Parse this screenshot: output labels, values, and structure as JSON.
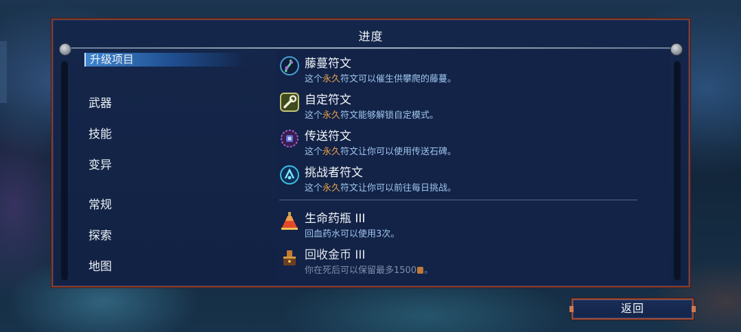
{
  "panel": {
    "title": "进度"
  },
  "categories": [
    {
      "label": "升级项目",
      "selected": true
    },
    {
      "label": "武器",
      "selected": false
    },
    {
      "label": "技能",
      "selected": false
    },
    {
      "label": "变异",
      "selected": false
    },
    {
      "label": "常规",
      "selected": false
    },
    {
      "label": "探索",
      "selected": false
    },
    {
      "label": "地图",
      "selected": false
    }
  ],
  "items": [
    {
      "name": "藤蔓符文",
      "desc_pre": "这个",
      "desc_hl": "永久",
      "desc_post": "符文可以催生供攀爬的藤蔓。",
      "icon": "vine-rune-icon"
    },
    {
      "name": "自定符文",
      "desc_pre": "这个",
      "desc_hl": "永久",
      "desc_post": "符文能够解锁自定模式。",
      "icon": "wrench-rune-icon"
    },
    {
      "name": "传送符文",
      "desc_pre": "这个",
      "desc_hl": "永久",
      "desc_post": "符文让你可以使用传送石碑。",
      "icon": "teleport-rune-icon"
    },
    {
      "name": "挑战者符文",
      "desc_pre": "这个",
      "desc_hl": "永久",
      "desc_post": "符文让你可以前往每日挑战。",
      "icon": "challenger-rune-icon"
    },
    {
      "name": "生命药瓶 III",
      "desc_pre": "回血药水可以使用3次。",
      "desc_hl": "",
      "desc_post": "",
      "icon": "health-flask-icon"
    },
    {
      "name": "回收金币 III",
      "desc_pre": "你在死后可以保留最多1500",
      "desc_hl": "",
      "desc_post": "。",
      "icon": "gold-recovery-icon"
    }
  ],
  "buttons": {
    "back": "返回"
  },
  "colors": {
    "highlight": "#e8a24a",
    "desc": "#9fc6ee",
    "frame": "#8a3a2a",
    "panel_bg": "#14264a"
  }
}
